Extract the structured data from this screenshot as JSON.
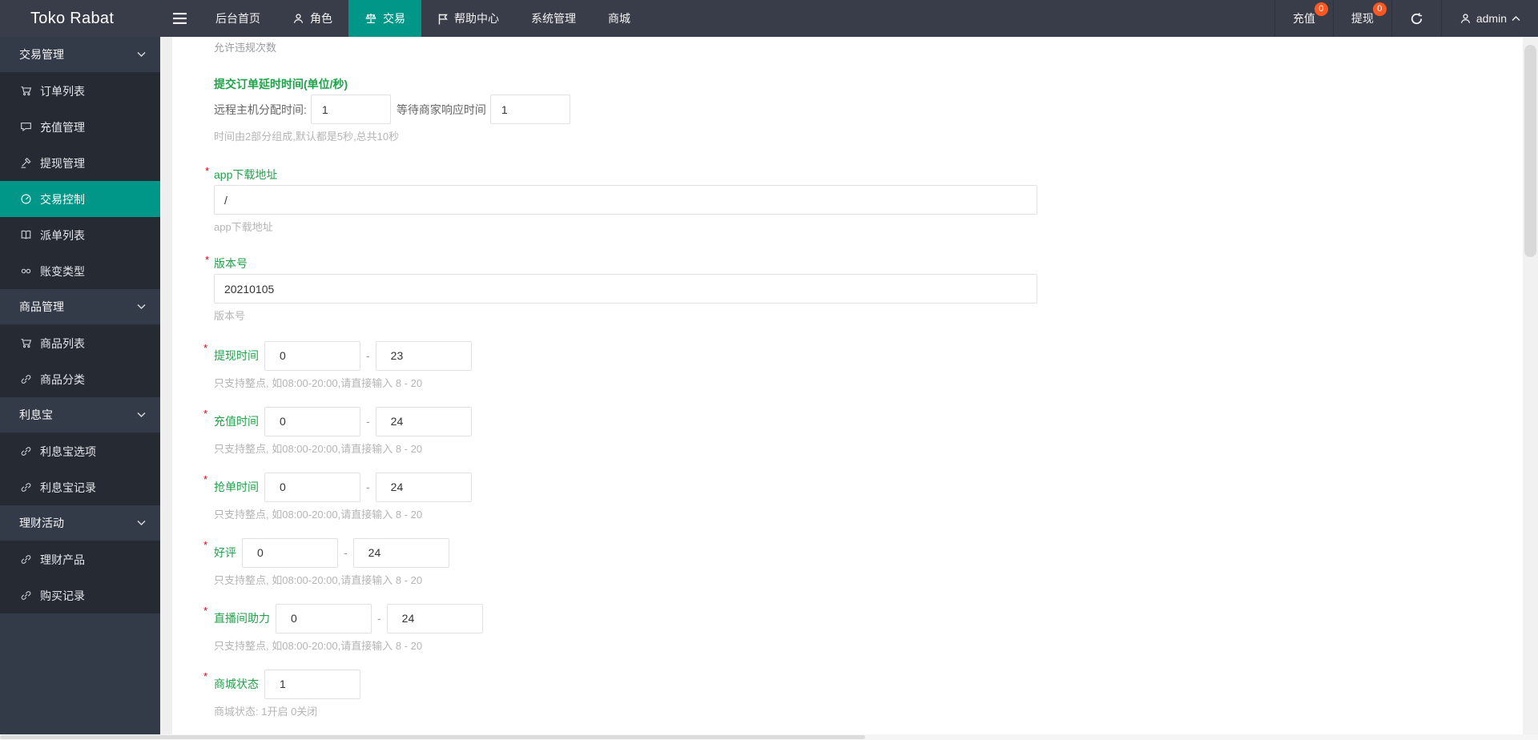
{
  "header": {
    "logo": "Toko Rabat",
    "nav": [
      {
        "label": "后台首页"
      },
      {
        "label": "角色"
      },
      {
        "label": "交易"
      },
      {
        "label": "帮助中心"
      },
      {
        "label": "系统管理"
      },
      {
        "label": "商城"
      }
    ],
    "right": {
      "recharge_label": "充值",
      "recharge_badge": "0",
      "withdraw_label": "提现",
      "withdraw_badge": "0",
      "username": "admin"
    }
  },
  "sidebar": {
    "groups": [
      {
        "label": "交易管理",
        "items": [
          {
            "label": "订单列表"
          },
          {
            "label": "充值管理"
          },
          {
            "label": "提现管理"
          },
          {
            "label": "交易控制"
          },
          {
            "label": "派单列表"
          },
          {
            "label": "账变类型"
          }
        ]
      },
      {
        "label": "商品管理",
        "items": [
          {
            "label": "商品列表"
          },
          {
            "label": "商品分类"
          }
        ]
      },
      {
        "label": "利息宝",
        "items": [
          {
            "label": "利息宝选项"
          },
          {
            "label": "利息宝记录"
          }
        ]
      },
      {
        "label": "理财活动",
        "items": [
          {
            "label": "理财产品"
          },
          {
            "label": "购买记录"
          }
        ]
      }
    ]
  },
  "form": {
    "top_hint": "允许违规次数",
    "section_title": "提交订单延时时间(单位/秒)",
    "required_mark": "*",
    "dash": "-",
    "delay": {
      "label1": "远程主机分配时间:",
      "value1": "1",
      "label2": "等待商家响应时间",
      "value2": "1",
      "help": "时间由2部分组成,默认都是5秒,总共10秒"
    },
    "app_url": {
      "label": "app下载地址",
      "value": "/",
      "help": "app下载地址"
    },
    "version": {
      "label": "版本号",
      "value": "20210105",
      "help": "版本号"
    },
    "range_help": "只支持整点, 如08:00-20:00,请直接输入 8 - 20",
    "ranges": [
      {
        "label": "提现时间",
        "from": "0",
        "to": "23"
      },
      {
        "label": "充值时间",
        "from": "0",
        "to": "24"
      },
      {
        "label": "抢单时间",
        "from": "0",
        "to": "24"
      },
      {
        "label": "好评",
        "from": "0",
        "to": "24"
      },
      {
        "label": "直播间助力",
        "from": "0",
        "to": "24"
      }
    ],
    "mall_status": {
      "label": "商城状态",
      "value": "1",
      "help": "商城状态: 1开启 0关闭"
    }
  },
  "colors": {
    "accent_teal": "#009688",
    "badge_orange": "#ff5722",
    "label_green": "#1fa34a",
    "required_red": "#e60012",
    "topbar_bg": "#393d49",
    "sidebar_bg": "#333a48"
  }
}
